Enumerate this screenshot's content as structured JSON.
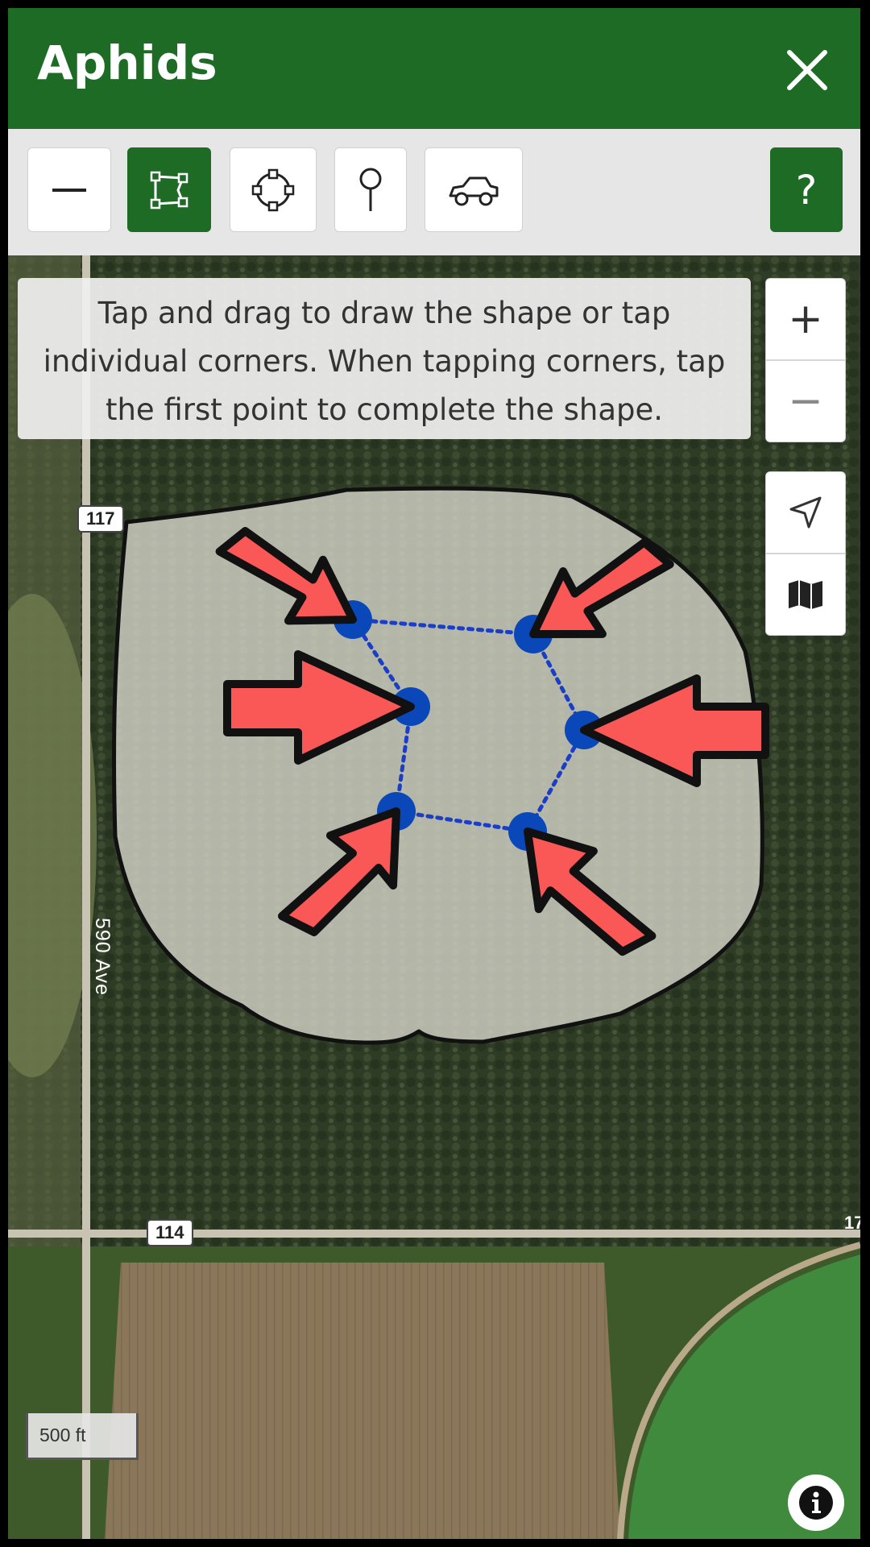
{
  "header": {
    "title": "Aphids",
    "close_icon": "close-icon",
    "color": "#1d6b25"
  },
  "toolbar": {
    "tools": [
      {
        "name": "line-tool",
        "icon": "minus-icon",
        "active": false
      },
      {
        "name": "polygon-tool",
        "icon": "polygon-icon",
        "active": true
      },
      {
        "name": "circle-tool",
        "icon": "circle-icon",
        "active": false
      },
      {
        "name": "pin-tool",
        "icon": "pin-icon",
        "active": false
      },
      {
        "name": "vehicle-tool",
        "icon": "car-icon",
        "active": false
      }
    ],
    "help_label": "?"
  },
  "map": {
    "hint": "Tap and drag to draw the shape or tap individual corners. When tapping corners, tap the first point to complete the shape.",
    "zoom_in_label": "+",
    "zoom_out_label": "−",
    "locate_icon": "navigation-arrow-icon",
    "layers_icon": "map-icon",
    "scale_label": "500 ft",
    "info_icon": "info-icon",
    "road_labels": {
      "r117": "117",
      "r114": "114",
      "r17": "17",
      "ave": "590 Ave"
    },
    "vertex_color": "#0a47b8",
    "arrow_color": "#fa5757",
    "vertex_count": 6
  }
}
